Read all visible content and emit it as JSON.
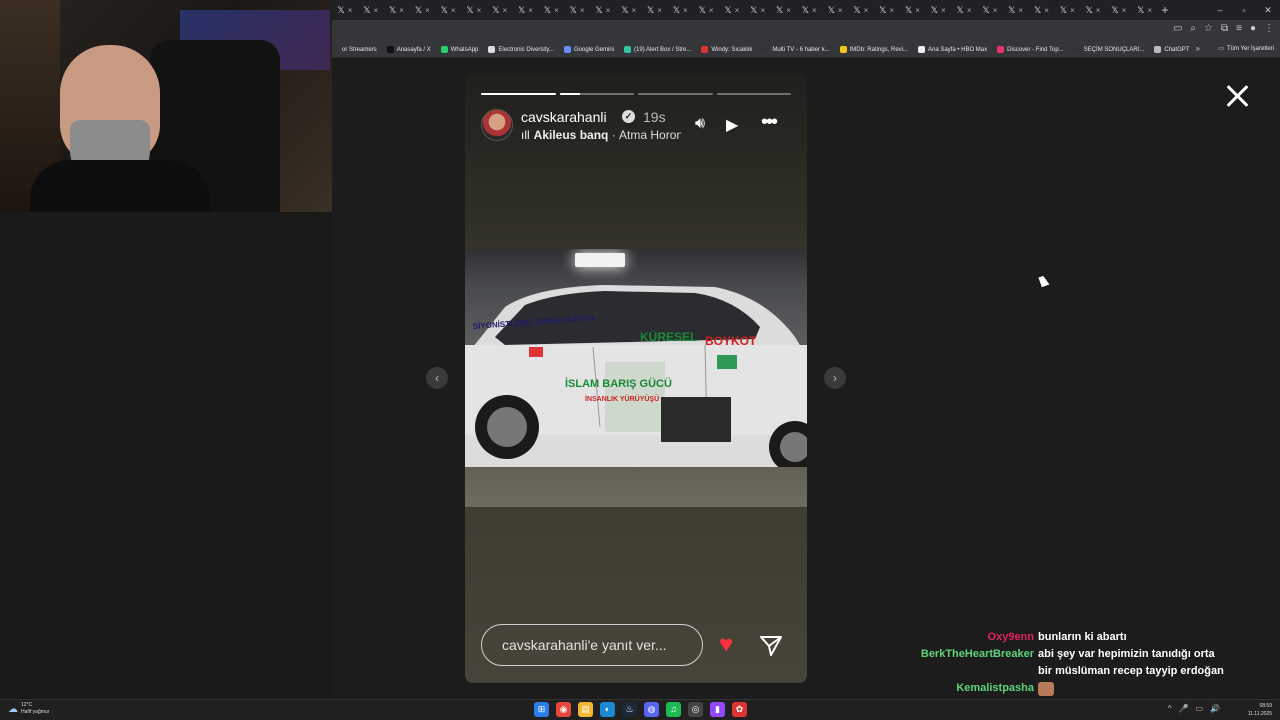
{
  "browser": {
    "tabs_count": 32,
    "new_tab": "+",
    "window_controls": [
      "–",
      "▫",
      "✕"
    ],
    "bookmarks": [
      {
        "label": "or Streamers",
        "color": "#35363a"
      },
      {
        "label": "Anasayfa / X",
        "color": "#111111"
      },
      {
        "label": "WhatsApp",
        "color": "#25d366"
      },
      {
        "label": "Electronic Diversity...",
        "color": "#dddddd"
      },
      {
        "label": "Google Gemini",
        "color": "#6a8cff"
      },
      {
        "label": "(19) Alert Box / Stre...",
        "color": "#31c3a2"
      },
      {
        "label": "Windy: Sıcaklık",
        "color": "#d33"
      },
      {
        "label": "Multi TV - 6 haber k...",
        "color": "#333333"
      },
      {
        "label": "IMDb: Ratings, Revi...",
        "color": "#f5c518"
      },
      {
        "label": "Ana Sayfa • HBO Max",
        "color": "#eeeeee"
      },
      {
        "label": "Discover - Find Top...",
        "color": "#e8336b"
      },
      {
        "label": "SEÇİM SONUÇLARI...",
        "color": "#333333"
      },
      {
        "label": "ChatGPT",
        "color": "#bbbbbb"
      }
    ],
    "bookmarks_more": "»",
    "all_bookmarks": "Tüm Yer İşaretleri"
  },
  "story": {
    "username": "cavskarahanli",
    "verified_mark": "✓",
    "time_ago": "19s",
    "music_artist": "Akileus banq",
    "music_separator": "·",
    "music_title": "Atma Horon",
    "progress": [
      1.0,
      0.28,
      0.0,
      0.0
    ],
    "reply_placeholder": "cavskarahanli'e yanıt ver...",
    "photo_text": {
      "line1": "SİYONİSTLERE, BUNAK BATIYA",
      "line2a": "KÜRESEL",
      "line2b": "BOYKOT",
      "line3": "İSLAM BARIŞ GÜCÜ",
      "line4": "İNSANLIK YÜRÜYÜŞÜ"
    }
  },
  "nav": {
    "prev": "‹",
    "next": "›"
  },
  "chat": [
    {
      "user": "Oxy9enn",
      "color": "#e0255a",
      "text": "bunların ki abartı"
    },
    {
      "user": "BerkTheHeartBreaker",
      "color": "#5fd37a",
      "text": "abi şey var hepimizin tanıdığı orta bir müslüman recep tayyip erdoğan"
    },
    {
      "user": "Kemalistpasha",
      "color": "#5fd37a",
      "text": "",
      "emote_color": "#b87a5a"
    },
    {
      "user": "BerkTheHeartBreaker",
      "color": "#5fd37a",
      "text": "",
      "emote_color": "#a0522d"
    }
  ],
  "taskbar": {
    "temp": "12°C",
    "weather": "Hafif yağmur",
    "apps": [
      {
        "name": "start",
        "glyph": "⊞",
        "color": "#2b7de9"
      },
      {
        "name": "chrome",
        "glyph": "◉",
        "color": "#e8453c"
      },
      {
        "name": "explorer",
        "glyph": "▤",
        "color": "#f2b632"
      },
      {
        "name": "edge",
        "glyph": "◐",
        "color": "#1a8ad4"
      },
      {
        "name": "steam",
        "glyph": "♨",
        "color": "#1b2838"
      },
      {
        "name": "discord",
        "glyph": "◍",
        "color": "#5865f2"
      },
      {
        "name": "spotify",
        "glyph": "♫",
        "color": "#1db954"
      },
      {
        "name": "obs",
        "glyph": "◎",
        "color": "#444444"
      },
      {
        "name": "twitch",
        "glyph": "▮",
        "color": "#9146ff"
      },
      {
        "name": "app",
        "glyph": "✿",
        "color": "#d33"
      }
    ],
    "tray": [
      "^",
      "🎤",
      "▭",
      "🔊"
    ],
    "time": "08:59",
    "date": "11.11.2025"
  }
}
